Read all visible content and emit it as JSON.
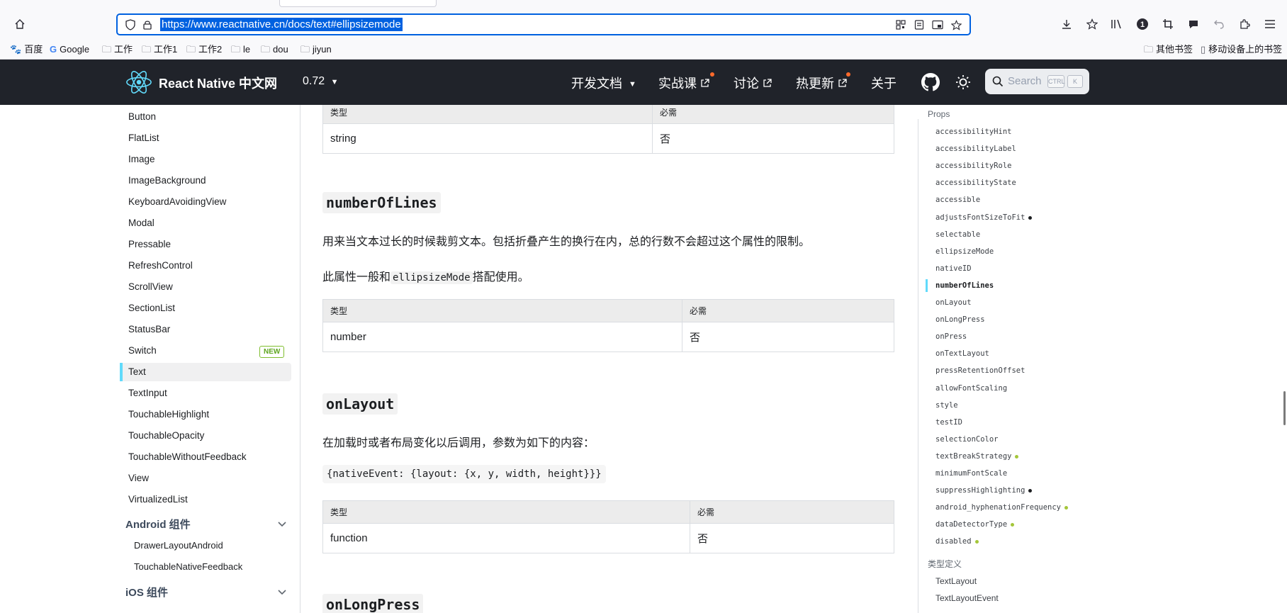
{
  "browser": {
    "url": "https://www.reactnative.cn/docs/text#ellipsizemode",
    "toolbar_icons": [
      "home-icon",
      "download-icon",
      "bookmark-star-icon",
      "library-icon",
      "badge-icon",
      "crop-icon",
      "chat-icon",
      "undo-icon",
      "extensions-icon",
      "menu-icon"
    ],
    "badge_count": "1",
    "bookmarks": [
      {
        "label": "百度",
        "icon": "baidu-icon"
      },
      {
        "label": "Google",
        "icon": "google-icon"
      },
      {
        "label": "工作",
        "icon": "folder-icon"
      },
      {
        "label": "工作1",
        "icon": "folder-icon"
      },
      {
        "label": "工作2",
        "icon": "folder-icon"
      },
      {
        "label": "le",
        "icon": "folder-icon"
      },
      {
        "label": "dou",
        "icon": "folder-icon"
      },
      {
        "label": "jiyun",
        "icon": "folder-icon"
      }
    ],
    "other_bookmarks": "其他书签",
    "mobile_bookmarks": "移动设备上的书签"
  },
  "site": {
    "title": "React Native 中文网",
    "version": "0.72",
    "nav": {
      "docs": "开发文档",
      "course": "实战课",
      "discuss": "讨论",
      "hot_update": "热更新",
      "about": "关于"
    },
    "search_placeholder": "Search",
    "kbd_ctrl": "CTRL",
    "kbd_k": "K",
    "accent_color": "#61dafb",
    "nav_bg": "#20232a"
  },
  "sidebar": {
    "items": [
      "Button",
      "FlatList",
      "Image",
      "ImageBackground",
      "KeyboardAvoidingView",
      "Modal",
      "Pressable",
      "RefreshControl",
      "ScrollView",
      "SectionList",
      "StatusBar",
      "Switch",
      "Text",
      "TextInput",
      "TouchableHighlight",
      "TouchableOpacity",
      "TouchableWithoutFeedback",
      "View",
      "VirtualizedList"
    ],
    "active": "Text",
    "new_badge": "NEW",
    "android_category": "Android 组件",
    "android_items": [
      "DrawerLayoutAndroid",
      "TouchableNativeFeedback"
    ],
    "ios_category": "iOS 组件"
  },
  "main": {
    "table_type_header": "类型",
    "table_required_header": "必需",
    "table_no": "否",
    "table1_type": "string",
    "numberOfLines": {
      "heading": "numberOfLines",
      "desc": "用来当文本过长的时候裁剪文本。包括折叠产生的换行在内，总的行数不会超过这个属性的限制。",
      "desc2_pre": "此属性一般和",
      "desc2_code": "ellipsizeMode",
      "desc2_post": "搭配使用。",
      "type": "number"
    },
    "onLayout": {
      "heading": "onLayout",
      "desc": "在加载时或者布局变化以后调用，参数为如下的内容：",
      "code": "{nativeEvent: {layout: {x, y, width, height}}}",
      "type": "function"
    },
    "onLongPress": {
      "heading": "onLongPress"
    }
  },
  "toc": {
    "props_header": "Props",
    "items": [
      {
        "label": "accessibilityHint",
        "dot": ""
      },
      {
        "label": "accessibilityLabel",
        "dot": ""
      },
      {
        "label": "accessibilityRole",
        "dot": ""
      },
      {
        "label": "accessibilityState",
        "dot": ""
      },
      {
        "label": "accessible",
        "dot": ""
      },
      {
        "label": "adjustsFontSizeToFit",
        "dot": "#1c1e21"
      },
      {
        "label": "selectable",
        "dot": ""
      },
      {
        "label": "ellipsizeMode",
        "dot": ""
      },
      {
        "label": "nativeID",
        "dot": ""
      },
      {
        "label": "numberOfLines",
        "dot": ""
      },
      {
        "label": "onLayout",
        "dot": ""
      },
      {
        "label": "onLongPress",
        "dot": ""
      },
      {
        "label": "onPress",
        "dot": ""
      },
      {
        "label": "onTextLayout",
        "dot": ""
      },
      {
        "label": "pressRetentionOffset",
        "dot": ""
      },
      {
        "label": "allowFontScaling",
        "dot": ""
      },
      {
        "label": "style",
        "dot": ""
      },
      {
        "label": "testID",
        "dot": ""
      },
      {
        "label": "selectionColor",
        "dot": ""
      },
      {
        "label": "textBreakStrategy",
        "dot": "#a4c639"
      },
      {
        "label": "minimumFontScale",
        "dot": ""
      },
      {
        "label": "suppressHighlighting",
        "dot": "#1c1e21"
      },
      {
        "label": "android_hyphenationFrequency",
        "dot": "#a4c639"
      },
      {
        "label": "dataDetectorType",
        "dot": "#a4c639"
      },
      {
        "label": "disabled",
        "dot": "#a4c639"
      }
    ],
    "active": "numberOfLines",
    "types_header": "类型定义",
    "type_items": [
      "TextLayout",
      "TextLayoutEvent"
    ]
  }
}
